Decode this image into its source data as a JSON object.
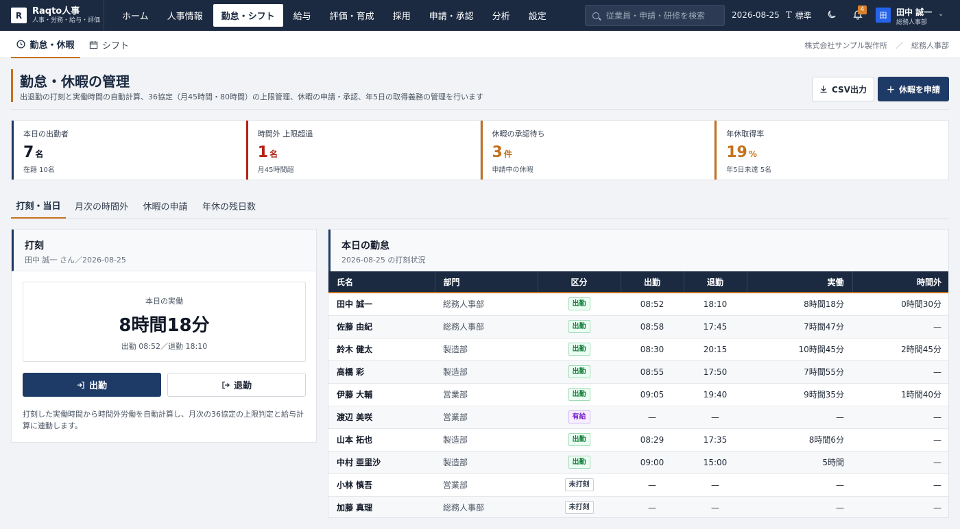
{
  "brand": {
    "logo": "R",
    "name": "Raqto人事",
    "sub": "人事・労務・給与・評価"
  },
  "nav": [
    {
      "label": "ホーム",
      "active": false
    },
    {
      "label": "人事情報",
      "active": false
    },
    {
      "label": "勤怠・シフト",
      "active": true
    },
    {
      "label": "給与",
      "active": false
    },
    {
      "label": "評価・育成",
      "active": false
    },
    {
      "label": "採用",
      "active": false
    },
    {
      "label": "申請・承認",
      "active": false
    },
    {
      "label": "分析",
      "active": false
    },
    {
      "label": "設定",
      "active": false
    }
  ],
  "search": {
    "placeholder": "従業員・申請・研修を検索"
  },
  "topbar": {
    "date": "2026-08-25",
    "density_label": "標準",
    "notification_count": "4"
  },
  "user": {
    "avatar": "田",
    "name": "田中 誠一",
    "dept": "総務人事部"
  },
  "subnav": {
    "tab1": "勤怠・休暇",
    "tab2": "シフト"
  },
  "breadcrumb": {
    "company": "株式会社サンプル製作所",
    "sep": "／",
    "dept": "総務人事部"
  },
  "page": {
    "title": "勤怠・休暇の管理",
    "desc": "出退勤の打刻と実働時間の自動計算、36協定（月45時間・80時間）の上限管理、休暇の申請・承認、年5日の取得義務の管理を行います",
    "csv_label": "CSV出力",
    "leave_label": "休暇を申請"
  },
  "kpis": [
    {
      "label": "本日の出勤者",
      "value": "7",
      "unit": "名",
      "sub": "在籍 10名",
      "color": "#1e3a66",
      "value_color": "#111827"
    },
    {
      "label": "時間外 上限超過",
      "value": "1",
      "unit": "名",
      "sub": "月45時間超",
      "color": "#b42318",
      "value_color": "#b42318"
    },
    {
      "label": "休暇の承認待ち",
      "value": "3",
      "unit": "件",
      "sub": "申請中の休暇",
      "color": "#c4711d",
      "value_color": "#c4711d"
    },
    {
      "label": "年休取得率",
      "value": "19",
      "unit": "%",
      "sub": "年5日未達 5名",
      "color": "#c4711d",
      "value_color": "#c4711d"
    }
  ],
  "tabs": [
    "打刻・当日",
    "月次の時間外",
    "休暇の申請",
    "年休の残日数"
  ],
  "punch": {
    "title": "打刻",
    "sub": "田中 誠一 さん／2026-08-25",
    "work_label": "本日の実働",
    "work_time": "8時間18分",
    "work_range": "出勤 08:52／退勤 18:10",
    "in_label": "出勤",
    "out_label": "退勤",
    "note": "打刻した実働時間から時間外労働を自動計算し、月次の36協定の上限判定と給与計算に連動します。"
  },
  "attendance": {
    "title": "本日の勤怠",
    "sub": "2026-08-25 の打刻状況",
    "columns": [
      "氏名",
      "部門",
      "区分",
      "出勤",
      "退勤",
      "実働",
      "時間外"
    ],
    "rows": [
      {
        "name": "田中 誠一",
        "dept": "総務人事部",
        "type": "出勤",
        "type_kind": "work",
        "in": "08:52",
        "out": "18:10",
        "work": "8時間18分",
        "ot": "0時間30分"
      },
      {
        "name": "佐藤 由紀",
        "dept": "総務人事部",
        "type": "出勤",
        "type_kind": "work",
        "in": "08:58",
        "out": "17:45",
        "work": "7時間47分",
        "ot": "—"
      },
      {
        "name": "鈴木 健太",
        "dept": "製造部",
        "type": "出勤",
        "type_kind": "work",
        "in": "08:30",
        "out": "20:15",
        "work": "10時間45分",
        "ot": "2時間45分"
      },
      {
        "name": "高橋 彩",
        "dept": "製造部",
        "type": "出勤",
        "type_kind": "work",
        "in": "08:55",
        "out": "17:50",
        "work": "7時間55分",
        "ot": "—"
      },
      {
        "name": "伊藤 大輔",
        "dept": "営業部",
        "type": "出勤",
        "type_kind": "work",
        "in": "09:05",
        "out": "19:40",
        "work": "9時間35分",
        "ot": "1時間40分"
      },
      {
        "name": "渡辺 美咲",
        "dept": "営業部",
        "type": "有給",
        "type_kind": "paid",
        "in": "—",
        "out": "—",
        "work": "—",
        "ot": "—"
      },
      {
        "name": "山本 拓也",
        "dept": "製造部",
        "type": "出勤",
        "type_kind": "work",
        "in": "08:29",
        "out": "17:35",
        "work": "8時間6分",
        "ot": "—"
      },
      {
        "name": "中村 亜里沙",
        "dept": "製造部",
        "type": "出勤",
        "type_kind": "work",
        "in": "09:00",
        "out": "15:00",
        "work": "5時間",
        "ot": "—"
      },
      {
        "name": "小林 慎吾",
        "dept": "営業部",
        "type": "未打刻",
        "type_kind": "none",
        "in": "—",
        "out": "—",
        "work": "—",
        "ot": "—"
      },
      {
        "name": "加藤 真理",
        "dept": "総務人事部",
        "type": "未打刻",
        "type_kind": "none",
        "in": "—",
        "out": "—",
        "work": "—",
        "ot": "—"
      }
    ]
  }
}
